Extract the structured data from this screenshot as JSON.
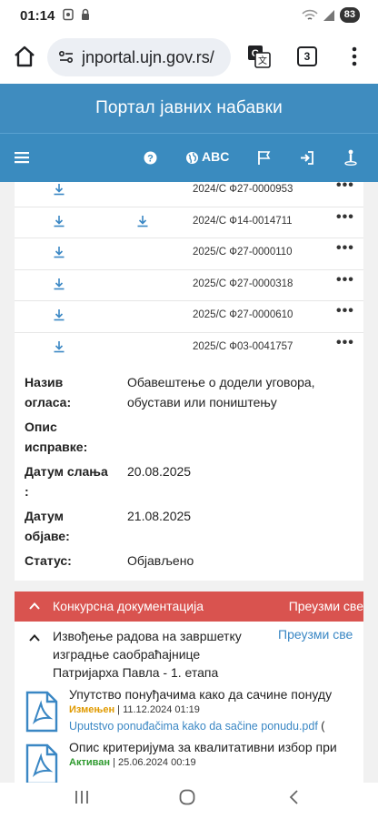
{
  "status_bar": {
    "time": "01:14",
    "battery": "83"
  },
  "browser": {
    "url": "jnportal.ujn.gov.rs/",
    "tab_count": "3"
  },
  "site": {
    "title": "Портал јавних набавки",
    "nav_language": "ABC"
  },
  "rows": [
    {
      "ref": "2024/С Ф27-0000953",
      "second_download": false
    },
    {
      "ref": "2024/С Ф14-0014711",
      "second_download": true
    },
    {
      "ref": "2025/С Ф27-0000110",
      "second_download": false
    },
    {
      "ref": "2025/С Ф27-0000318",
      "second_download": false
    },
    {
      "ref": "2025/С Ф27-0000610",
      "second_download": false
    },
    {
      "ref": "2025/С Ф03-0041757",
      "second_download": false
    }
  ],
  "row_actions": "•••",
  "details": {
    "notice_name_label": "Назив огласа:",
    "notice_name_value": "Обавештење о додели уговора, обустави или поништењу",
    "correction_label": "Опис исправке:",
    "sent_date_label": "Датум слања :",
    "sent_date_value": "20.08.2025",
    "published_date_label": "Датум објаве:",
    "published_date_value": "21.08.2025",
    "status_label": "Статус:",
    "status_value": "Објављено"
  },
  "konkursna": {
    "title": "Конкурсна документација",
    "download_all": "Преузми све"
  },
  "section": {
    "title": "Извођење радова на завршетку изградње саобраћајнице Патријарха Павла - 1. етапа",
    "download_all": "Преузми све"
  },
  "documents": [
    {
      "title": "Упутство понуђачима како да сачине понуду",
      "status": "Измењен",
      "date": "11.12.2024 01:19",
      "file": "Uputstvo ponuđačima kako da sačine ponudu.pdf",
      "file_suffix": "(",
      "status_color": "#e09a00"
    },
    {
      "title": "Опис критеријума за квалитативни избор при",
      "status": "Активан",
      "date": "25.06.2024 00:19",
      "status_color": "#2e9a2e"
    }
  ],
  "colors": {
    "header": "#3f8cbf",
    "konkursna_bar": "#d9534f",
    "link": "#3a87c4"
  }
}
